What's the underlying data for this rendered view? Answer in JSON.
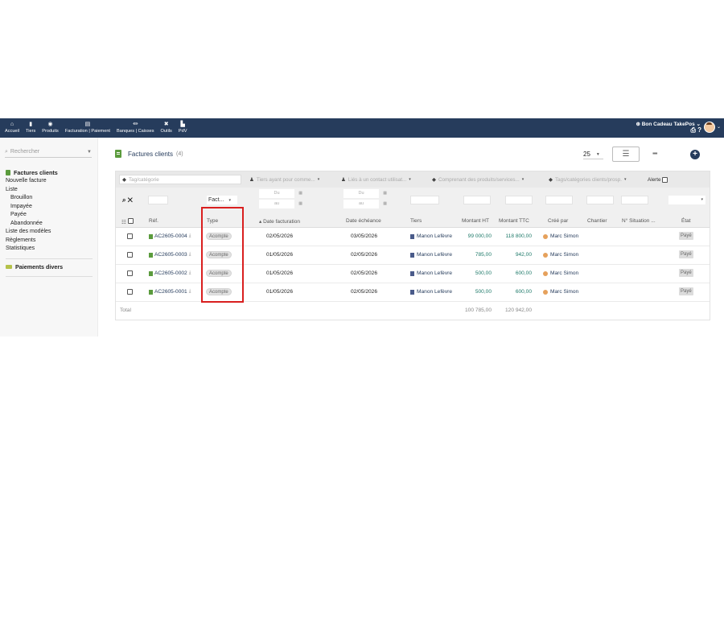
{
  "topbar": {
    "nav": [
      {
        "label": "Accueil",
        "icon": "home-icon",
        "glyph": "⌂"
      },
      {
        "label": "Tiers",
        "icon": "building-icon",
        "glyph": "▮"
      },
      {
        "label": "Produits",
        "icon": "cube-icon",
        "glyph": "◉"
      },
      {
        "label": "Facturation | Paiement",
        "icon": "invoice-icon",
        "glyph": "▤"
      },
      {
        "label": "Banques | Caisses",
        "icon": "bank-icon",
        "glyph": "⏛"
      },
      {
        "label": "Outils",
        "icon": "tools-icon",
        "glyph": "✖"
      },
      {
        "label": "PdV",
        "icon": "cash-register-icon",
        "glyph": "▙"
      }
    ],
    "company": "Bon Cadeau TakePos",
    "company_caret": "⌄",
    "globe_glyph": "⊕",
    "icons_glyph": "⎙ ?",
    "user_caret": "⌄"
  },
  "sidebar": {
    "search_placeholder": "Rechercher",
    "search_glyph": "⌕",
    "caret_glyph": "▼",
    "section_title": "Factures clients",
    "items": [
      {
        "label": "Nouvelle facture",
        "sub": false
      },
      {
        "label": "Liste",
        "sub": false
      },
      {
        "label": "Brouillon",
        "sub": true
      },
      {
        "label": "Impayée",
        "sub": true
      },
      {
        "label": "Payée",
        "sub": true
      },
      {
        "label": "Abandonnée",
        "sub": true
      },
      {
        "label": "Liste des modèles",
        "sub": false
      },
      {
        "label": "Règlements",
        "sub": false
      },
      {
        "label": "Statistiques",
        "sub": false
      }
    ],
    "section2_title": "Paiements divers"
  },
  "main": {
    "title": "Factures clients",
    "count": "(4)",
    "page_size": "25",
    "page_size_caret": "▼",
    "list_glyph": "☰",
    "kanban_glyph": "▪▪▪",
    "add_glyph": "+"
  },
  "filters": {
    "tag": "Tag/catégorie",
    "thirdparty": "Tiers ayant pour comme...",
    "contact": "Liés à un contact utilisat...",
    "products": "Comprenant des produits/services...",
    "customer_tags": "Tags/catégories clients/prosp.",
    "alert": "Alerte",
    "tag_glyph": "◆",
    "user_glyph": "♟",
    "caret_glyph": "▾"
  },
  "search_row": {
    "search_glyph": "⌕",
    "clear_glyph": "✕",
    "type_value": "Fact...",
    "caret_glyph": "▾",
    "date_from": "Du",
    "date_to": "au"
  },
  "columns": {
    "ref": "Réf.",
    "type": "Type",
    "date_fact": "▴ Date facturation",
    "date_due": "Date échéance",
    "tiers": "Tiers",
    "montant_ht": "Montant HT",
    "montant_ttc": "Montant TTC",
    "created_by": "Créé par",
    "chantier": "Chantier",
    "situation": "N° Situation ...",
    "state": "État",
    "list_glyph": "☷"
  },
  "rows": [
    {
      "ref": "AC2605-0004",
      "type": "Acompte",
      "date_fact": "02/05/2026",
      "date_due": "03/05/2026",
      "tiers": "Manon Lefèvre",
      "ht": "99 000,00",
      "ttc": "118 800,00",
      "user": "Marc Simon",
      "state": "Payé"
    },
    {
      "ref": "AC2605-0003",
      "type": "Acompte",
      "date_fact": "01/05/2026",
      "date_due": "02/05/2026",
      "tiers": "Manon Lefèvre",
      "ht": "785,00",
      "ttc": "942,00",
      "user": "Marc Simon",
      "state": "Payé"
    },
    {
      "ref": "AC2605-0002",
      "type": "Acompte",
      "date_fact": "01/05/2026",
      "date_due": "02/05/2026",
      "tiers": "Manon Lefèvre",
      "ht": "500,00",
      "ttc": "600,00",
      "user": "Marc Simon",
      "state": "Payé"
    },
    {
      "ref": "AC2605-0001",
      "type": "Acompte",
      "date_fact": "01/05/2026",
      "date_due": "02/05/2026",
      "tiers": "Manon Lefèvre",
      "ht": "500,00",
      "ttc": "600,00",
      "user": "Marc Simon",
      "state": "Payé"
    }
  ],
  "pdf_glyph": "⤓",
  "totals": {
    "label": "Total",
    "ht": "100 785,00",
    "ttc": "120 942,00"
  },
  "colors": {
    "topbar": "#263c5c",
    "accent_green": "#5b9b3d",
    "amount": "#1f7a6a",
    "highlight": "#d91f1f"
  }
}
